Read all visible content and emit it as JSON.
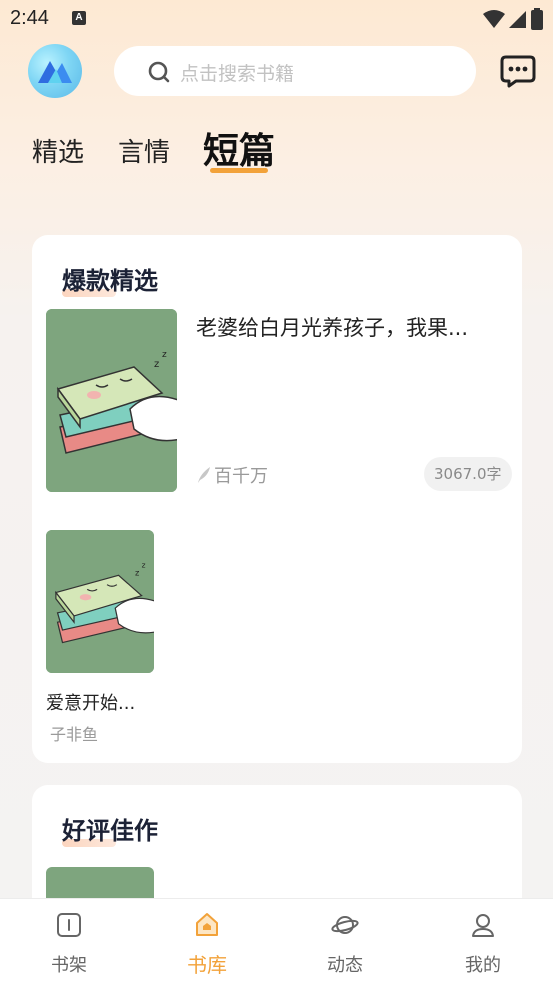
{
  "status_bar": {
    "time": "2:44",
    "notif_letter": "A"
  },
  "search": {
    "placeholder": "点击搜索书籍"
  },
  "tabs": [
    {
      "label": "精选",
      "active": false
    },
    {
      "label": "言情",
      "active": false
    },
    {
      "label": "短篇",
      "active": true
    }
  ],
  "featured": {
    "title": "爆款精选",
    "books": [
      {
        "title": "老婆给白月光养孩子，我果...",
        "author": "百千万",
        "word_count": "3067.0字"
      },
      {
        "title": "爱意开始...",
        "author": "子非鱼"
      }
    ]
  },
  "acclaimed": {
    "title": "好评佳作"
  },
  "bottom_nav": [
    {
      "label": "书架",
      "icon": "bookshelf-icon",
      "active": false
    },
    {
      "label": "书库",
      "icon": "library-icon",
      "active": true
    },
    {
      "label": "动态",
      "icon": "planet-icon",
      "active": false
    },
    {
      "label": "我的",
      "icon": "profile-icon",
      "active": false
    }
  ],
  "colors": {
    "accent": "#f2a23a",
    "cover_green": "#7ea57e"
  }
}
